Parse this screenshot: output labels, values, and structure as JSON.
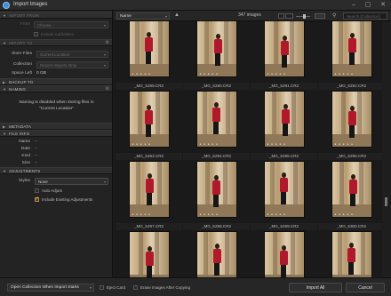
{
  "window": {
    "title": "Import Images"
  },
  "left_panel": {
    "import_from": {
      "header": "IMPORT FROM",
      "from_label": "From",
      "from_value": "Choose...",
      "include_subfolders": "Include Subfolders"
    },
    "import_to": {
      "header": "IMPORT TO",
      "store_files_label": "Store Files",
      "store_files_value": "Current Location",
      "collection_label": "Collection",
      "collection_value": "Recent Imports Only",
      "space_left_label": "Space Left",
      "space_left_value": "0 GB"
    },
    "backup_to": {
      "header": "BACKUP TO"
    },
    "naming": {
      "header": "NAMING",
      "message_line1": "Naming is disabled when storing files in",
      "message_line2": "\"Current Location\""
    },
    "metadata": {
      "header": "METADATA"
    },
    "file_info": {
      "header": "FILE INFO",
      "name_label": "Name",
      "date_label": "Date",
      "kind_label": "Kind",
      "size_label": "Size",
      "name_value": "--",
      "date_value": "--",
      "kind_value": "--",
      "size_value": "--"
    },
    "adjustments": {
      "header": "ADJUSTMENTS",
      "styles_label": "Styles",
      "styles_value": "None",
      "auto_adjust": "Auto Adjust",
      "auto_adjust_checked": false,
      "include_existing": "Include Existing Adjustments",
      "include_existing_checked": true
    }
  },
  "toolbar": {
    "sort_value": "Name",
    "image_count": "347 images",
    "search_placeholder": "Search [Collection]"
  },
  "images": [
    {
      "name": "_MG_5289.CR2",
      "orientation": "portrait"
    },
    {
      "name": "_MG_5290.CR2",
      "orientation": "portrait"
    },
    {
      "name": "_MG_5291.CR2",
      "orientation": "portrait"
    },
    {
      "name": "_MG_5292.CR2",
      "orientation": "portrait"
    },
    {
      "name": "_MG_5293.CR2",
      "orientation": "portrait"
    },
    {
      "name": "_MG_5294.CR2",
      "orientation": "portrait"
    },
    {
      "name": "_MG_5295.CR2",
      "orientation": "portrait"
    },
    {
      "name": "_MG_5296.CR2",
      "orientation": "portrait"
    },
    {
      "name": "_MG_5297.CR2",
      "orientation": "portrait"
    },
    {
      "name": "_MG_5298.CR2",
      "orientation": "portrait"
    },
    {
      "name": "_MG_5299.CR2",
      "orientation": "portrait"
    },
    {
      "name": "_MG_5300.CR2",
      "orientation": "portrait"
    },
    {
      "name": "",
      "orientation": "portrait"
    },
    {
      "name": "",
      "orientation": "portrait"
    },
    {
      "name": "",
      "orientation": "portrait"
    },
    {
      "name": "",
      "orientation": "portrait"
    }
  ],
  "bottom": {
    "open_collection_value": "Open Collection When Import Starts",
    "eject_card": "Eject Card",
    "eject_card_checked": false,
    "erase_images": "Erase Images After Copying",
    "erase_images_checked": false,
    "import_all": "Import All",
    "cancel": "Cancel"
  },
  "colors": {
    "accent": "#e8a84a",
    "panel": "#232323",
    "background": "#1a1a1a"
  }
}
